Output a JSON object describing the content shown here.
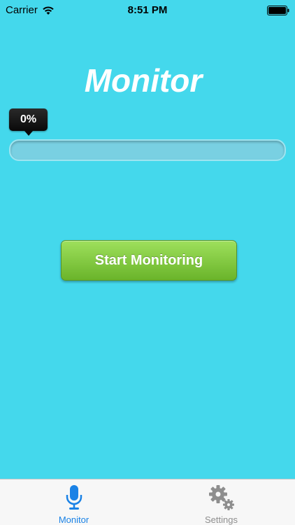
{
  "status_bar": {
    "carrier": "Carrier",
    "time": "8:51 PM",
    "wifi_icon": "wifi-icon",
    "battery_icon": "battery-icon"
  },
  "main": {
    "title": "Monitor",
    "progress_label": "0%",
    "progress_value": 0,
    "start_button_label": "Start Monitoring"
  },
  "tab_bar": {
    "tabs": [
      {
        "label": "Monitor",
        "icon": "microphone-icon",
        "selected": true
      },
      {
        "label": "Settings",
        "icon": "gears-icon",
        "selected": false
      }
    ]
  },
  "colors": {
    "background": "#44d8ec",
    "button_green": "#7dc63a",
    "tab_active": "#1a82e6",
    "tab_inactive": "#8e8e8e"
  }
}
